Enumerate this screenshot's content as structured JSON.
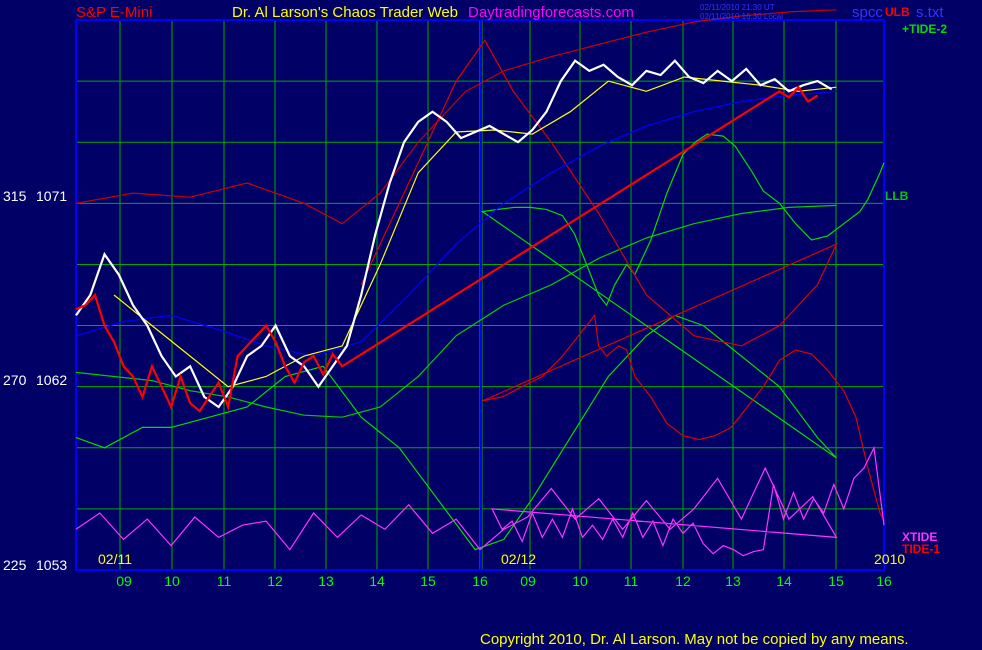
{
  "header": {
    "symbol": "S&P E-Mini",
    "title": "Dr. Al Larson's Chaos Trader Web",
    "site": "Daytradingforecasts.com",
    "timestamp_ut": "02/11/2010 21:30 UT",
    "timestamp_local": "02/11/2010 16:30 Local",
    "file": "spcc",
    "file_suffix": "s.txt"
  },
  "footer": {
    "copyright": "Copyright 2010, Dr. Al Larson. May not be copied by any means."
  },
  "colors": {
    "background": "#000066",
    "grid": "#00aa00",
    "frame": "#0000ff",
    "price_up": "#ffffff",
    "price_down": "#ff0000",
    "ulb": "#cc0000",
    "llb": "#00cc00",
    "tide2": "#00dd00",
    "tide1": "#dd0000",
    "xtide": "#ff33ff",
    "ma_blue": "#0000ff",
    "ma_yellow": "#ffff00"
  },
  "chart_data": {
    "type": "line",
    "x_axis": {
      "tick_labels": [
        "09",
        "10",
        "11",
        "12",
        "13",
        "14",
        "15",
        "16",
        "09",
        "10",
        "11",
        "12",
        "13",
        "14",
        "15",
        "16"
      ],
      "date_labels": [
        "02/11",
        "02/12"
      ],
      "year_label": "2010"
    },
    "y_axis": {
      "tick_labels": [
        {
          "left": "315",
          "right": "1071",
          "value": 1071
        },
        {
          "left": "270",
          "right": "1062",
          "value": 1062
        },
        {
          "left": "225",
          "right": "1053",
          "value": 1053
        }
      ],
      "range": [
        1053,
        1080
      ]
    },
    "series": [
      {
        "name": "ULB",
        "color": "#cc0000",
        "x": [
          8.0,
          8.6,
          9.2,
          9.8,
          10.4,
          10.8,
          11.2,
          11.6,
          12.1,
          12.5,
          13.0,
          13.5,
          14.0,
          14.5,
          15.0,
          15.5,
          16.0
        ],
        "y": [
          1071.0,
          1071.5,
          1071.3,
          1072.0,
          1071.0,
          1070.0,
          1071.5,
          1074.0,
          1076.5,
          1077.5,
          1078.2,
          1078.8,
          1079.4,
          1079.9,
          1080.2,
          1080.4,
          1080.5
        ]
      },
      {
        "name": "LLB",
        "color": "#00cc00",
        "x": [
          8.0,
          8.4,
          8.8,
          9.2,
          9.6,
          10.0,
          10.4,
          10.8,
          11.2,
          11.6,
          12.0,
          12.5,
          13.0,
          13.5,
          14.0,
          14.5,
          15.0,
          15.5,
          16.0
        ],
        "y": [
          1062.7,
          1062.5,
          1062.3,
          1061.8,
          1061.5,
          1061.0,
          1060.6,
          1060.5,
          1061.0,
          1062.5,
          1064.5,
          1066.0,
          1067.0,
          1068.3,
          1069.3,
          1070.0,
          1070.5,
          1070.8,
          1070.9
        ]
      },
      {
        "name": "+TIDE-2",
        "color": "#00dd00",
        "x": [
          8.0,
          8.3,
          8.7,
          9.0,
          9.4,
          9.8,
          10.2,
          10.6,
          11.0,
          11.4,
          11.8,
          12.2,
          12.5,
          12.8,
          13.2,
          13.6,
          14.0,
          14.3,
          14.6,
          15.0,
          15.4,
          15.8,
          16.0,
          16.01,
          16.4,
          16.8,
          17.2,
          17.6,
          18.0,
          18.3,
          18.6,
          18.9,
          19.1,
          19.3,
          19.6,
          19.8,
          20.2,
          20.6,
          21.0,
          21.3,
          21.6,
          22.0,
          22.3,
          22.7,
          23.0,
          23.4,
          23.8,
          24.2,
          24.6,
          25.0,
          25.4,
          25.6,
          25.9,
          26.0
        ],
        "y": [
          1059.5,
          1059.0,
          1060.0,
          1060.0,
          1060.5,
          1061.0,
          1062.5,
          1063.0,
          1060.5,
          1059.0,
          1056.5,
          1054.0,
          1054.5,
          1056.5,
          1059.5,
          1062.5,
          1064.5,
          1065.5,
          1065.0,
          1063.5,
          1062.0,
          1059.5,
          1058.5,
          1070.6,
          1070.7,
          1070.8,
          1070.8,
          1070.7,
          1070.4,
          1069.5,
          1068.0,
          1066.5,
          1066.0,
          1067.0,
          1068.0,
          1067.5,
          1069.2,
          1071.5,
          1073.4,
          1074.0,
          1074.4,
          1074.3,
          1073.8,
          1072.6,
          1071.6,
          1071.0,
          1070.0,
          1069.2,
          1069.4,
          1070.0,
          1070.6,
          1071.2,
          1072.5,
          1073.0
        ]
      },
      {
        "name": "TIDE-1",
        "color": "#dd0000",
        "x": [
          11.0,
          11.5,
          12.0,
          12.3,
          12.6,
          13.0,
          13.5,
          14.0,
          14.5,
          15.0,
          15.4,
          15.8,
          16.0,
          16.01,
          16.5,
          17.0,
          17.5,
          18.0,
          18.4,
          18.8,
          18.9,
          19.1,
          19.4,
          19.6,
          19.8,
          20.2,
          20.6,
          21.0,
          21.4,
          21.8,
          22.2,
          22.6,
          23.0,
          23.4,
          23.8,
          24.2,
          24.6,
          25.0,
          25.3,
          25.6,
          25.9,
          26.0
        ],
        "y": [
          1067.0,
          1072.0,
          1077.0,
          1079.0,
          1076.5,
          1074.0,
          1070.5,
          1066.5,
          1064.5,
          1064.0,
          1065.0,
          1067.0,
          1069.0,
          1061.3,
          1061.5,
          1062.0,
          1062.5,
          1063.5,
          1064.5,
          1065.5,
          1064.0,
          1063.5,
          1064.0,
          1063.8,
          1062.5,
          1061.5,
          1060.2,
          1059.6,
          1059.4,
          1059.6,
          1060.0,
          1061.0,
          1062.0,
          1063.3,
          1063.8,
          1063.6,
          1062.8,
          1061.8,
          1060.5,
          1058.0,
          1055.8,
          1055.4
        ]
      },
      {
        "name": "XTIDE",
        "color": "#ff33ff",
        "x": [
          8.0,
          8.25,
          8.5,
          8.75,
          9.0,
          9.25,
          9.5,
          9.75,
          10.0,
          10.25,
          10.5,
          10.75,
          11.0,
          11.25,
          11.5,
          11.75,
          12.0,
          12.25,
          12.5,
          12.75,
          13.0,
          13.25,
          13.5,
          13.75,
          14.0,
          14.25,
          14.5,
          14.75,
          15.0,
          15.25,
          15.5,
          15.75,
          16.0,
          16.25,
          16.5,
          16.75,
          17.0,
          17.25,
          17.5,
          17.75,
          18.0,
          18.25,
          18.5,
          18.75,
          19.0,
          19.25,
          19.5,
          19.75,
          20.0,
          20.25,
          20.5,
          20.75,
          21.0,
          21.25,
          21.5,
          21.75,
          22.0,
          22.25,
          22.5,
          22.75,
          23.0,
          23.25,
          23.5,
          23.75,
          24.0,
          24.25,
          24.5,
          24.75,
          25.0,
          25.25,
          25.5,
          25.75,
          26.0
        ],
        "y": [
          1055.0,
          1055.8,
          1054.5,
          1055.5,
          1054.2,
          1055.6,
          1054.6,
          1055.2,
          1055.4,
          1054.0,
          1055.8,
          1054.6,
          1055.7,
          1055.0,
          1056.2,
          1054.8,
          1055.5,
          1054.0,
          1055.0,
          1055.6,
          1057.0,
          1055.5,
          1056.5,
          1055.0,
          1056.4,
          1055.0,
          1056.0,
          1057.5,
          1055.5,
          1058.0,
          1055.5,
          1056.6,
          1054.6,
          1056.0,
          1055.0,
          1055.4,
          1054.4,
          1055.8,
          1054.6,
          1055.5,
          1054.6,
          1056.0,
          1054.6,
          1055.2,
          1054.5,
          1055.5,
          1054.6,
          1055.8,
          1054.6,
          1055.4,
          1054.2,
          1055.5,
          1054.8,
          1055.3,
          1054.3,
          1053.8,
          1054.2,
          1054.0,
          1053.7,
          1053.9,
          1054.0,
          1057.2,
          1055.5,
          1056.8,
          1055.5,
          1056.5,
          1055.8,
          1057.2,
          1056.0,
          1057.5,
          1058.0,
          1059.0,
          1055.2
        ]
      },
      {
        "name": "",
        "color": "#0000ff",
        "x": [
          8.0,
          8.5,
          9.0,
          9.5,
          10.0,
          10.5,
          11.0,
          11.5,
          12.0,
          12.5,
          13.0,
          13.5,
          14.0,
          14.5,
          15.0,
          15.5,
          16.0
        ],
        "y": [
          1064.5,
          1065.2,
          1065.5,
          1064.8,
          1064.0,
          1063.5,
          1064.2,
          1066.5,
          1069.0,
          1071.0,
          1072.5,
          1073.8,
          1074.8,
          1075.5,
          1076.0,
          1076.3,
          1076.5
        ]
      },
      {
        "name": "",
        "color": "#ffff00",
        "x": [
          8.4,
          8.8,
          9.2,
          9.6,
          10.0,
          10.4,
          10.8,
          11.2,
          11.6,
          12.0,
          12.4,
          12.8,
          13.2,
          13.6,
          14.0,
          14.4,
          14.8,
          15.2,
          15.6,
          16.0
        ],
        "y": [
          1066.5,
          1065.0,
          1063.5,
          1062.0,
          1062.5,
          1063.5,
          1064.0,
          1068.0,
          1072.5,
          1074.5,
          1074.6,
          1074.4,
          1075.5,
          1077.0,
          1076.5,
          1077.2,
          1077.0,
          1076.8,
          1076.5,
          1076.7
        ]
      },
      {
        "name": "",
        "color": "#ffffff",
        "x": [
          8.0,
          8.15,
          8.3,
          8.45,
          8.6,
          8.75,
          8.9,
          9.05,
          9.2,
          9.35,
          9.5,
          9.65,
          9.8,
          9.95,
          10.1,
          10.25,
          10.4,
          10.55,
          10.7,
          10.85,
          11.0,
          11.15,
          11.3,
          11.45,
          11.6,
          11.75,
          11.9,
          12.05,
          12.2,
          12.35,
          12.5,
          12.65,
          12.8,
          12.95,
          13.1,
          13.25,
          13.4,
          13.55,
          13.7,
          13.85,
          14.0,
          14.15,
          14.3,
          14.45,
          14.6,
          14.75,
          14.9,
          15.05,
          15.2,
          15.35,
          15.5,
          15.65,
          15.8,
          15.95
        ],
        "y": [
          1065.5,
          1066.5,
          1068.5,
          1067.5,
          1066.0,
          1065.0,
          1063.5,
          1062.5,
          1063.0,
          1061.5,
          1061.0,
          1062.0,
          1063.5,
          1064.0,
          1065.0,
          1063.5,
          1063.0,
          1062.0,
          1063.0,
          1064.0,
          1066.5,
          1069.5,
          1072.0,
          1074.0,
          1075.0,
          1075.5,
          1075.0,
          1074.2,
          1074.5,
          1074.8,
          1074.4,
          1074.0,
          1074.6,
          1075.5,
          1077.0,
          1078.0,
          1077.5,
          1077.8,
          1077.2,
          1076.8,
          1077.5,
          1077.3,
          1078.0,
          1077.2,
          1076.9,
          1077.5,
          1077.0,
          1077.6,
          1076.8,
          1077.1,
          1076.5,
          1076.8,
          1077.0,
          1076.6
        ]
      },
      {
        "name": "",
        "color": "#ff0000",
        "x": [
          8.0,
          8.1,
          8.2,
          8.3,
          8.4,
          8.5,
          8.6,
          8.7,
          8.8,
          8.9,
          9.0,
          9.1,
          9.2,
          9.3,
          9.4,
          9.5,
          9.6,
          9.7,
          9.8,
          9.9,
          10.0,
          10.1,
          10.2,
          10.3,
          10.4,
          10.5,
          10.6,
          10.7,
          10.8,
          15.4,
          15.5,
          15.6,
          15.7,
          15.8
        ],
        "y": [
          1065.8,
          1066.0,
          1066.5,
          1065.0,
          1064.2,
          1063.0,
          1062.5,
          1061.5,
          1063.0,
          1062.0,
          1061.0,
          1062.5,
          1061.2,
          1060.8,
          1061.5,
          1062.2,
          1061.0,
          1063.5,
          1064.0,
          1064.5,
          1065.0,
          1064.2,
          1063.0,
          1062.2,
          1063.2,
          1063.5,
          1062.6,
          1063.6,
          1063.0,
          1076.5,
          1076.2,
          1076.7,
          1076.0,
          1076.3
        ]
      }
    ]
  }
}
